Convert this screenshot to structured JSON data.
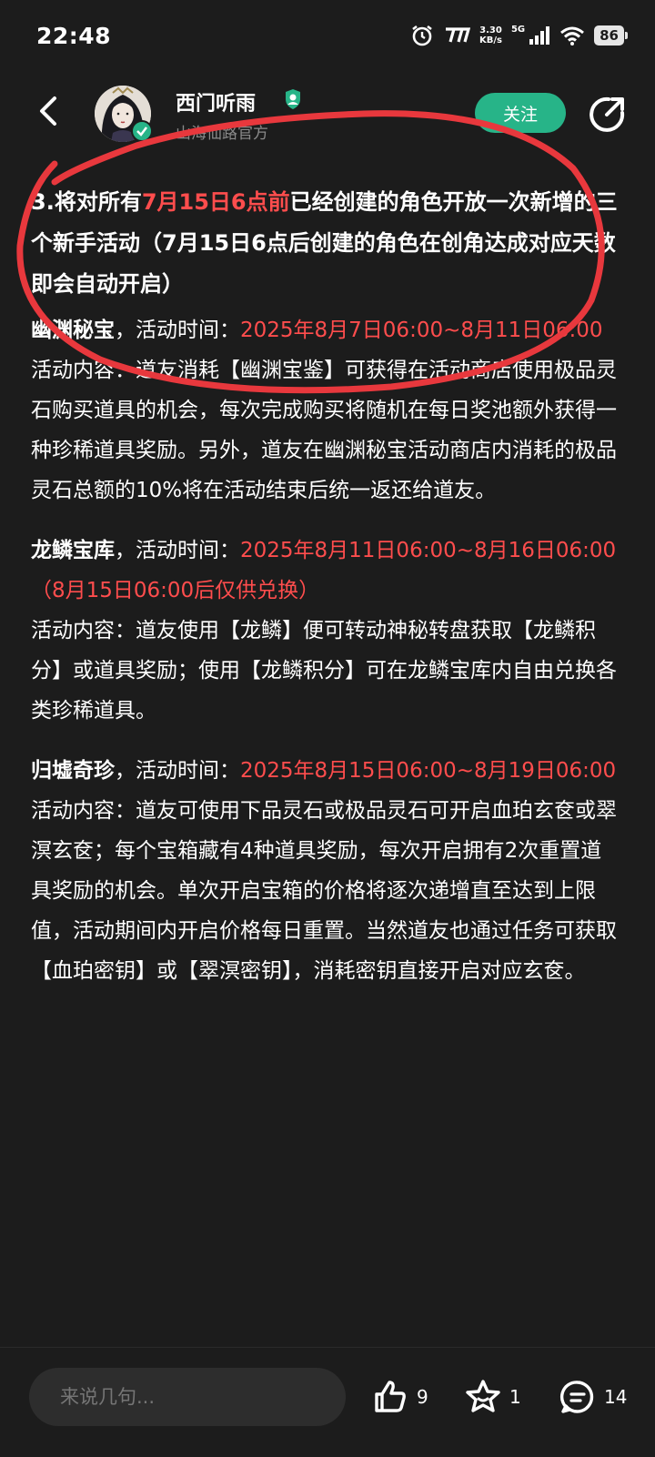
{
  "status_bar": {
    "time": "22:48",
    "net_speed_value": "3.30",
    "net_speed_unit": "KB/s",
    "network": "5G",
    "battery": "86"
  },
  "header": {
    "author_name": "西门听雨",
    "author_subtitle": "山海仙路官方",
    "follow_label": "关注"
  },
  "post": {
    "intro": {
      "prefix": "3.将对所有",
      "highlight": "7月15日6点前",
      "suffix": "已经创建的角色开放一次新增的三个新手活动（7月15日6点后创建的角色在创角达成对应天数即会自动开启）"
    },
    "activities": [
      {
        "name": "幽渊秘宝",
        "time_label": "，活动时间：",
        "time": "2025年8月7日06:00~8月11日06:00",
        "content": "活动内容：道友消耗【幽渊宝鉴】可获得在活动商店使用极品灵石购买道具的机会，每次完成购买将随机在每日奖池额外获得一种珍稀道具奖励。另外，道友在幽渊秘宝活动商店内消耗的极品灵石总额的10%将在活动结束后统一返还给道友。"
      },
      {
        "name": "龙鳞宝库",
        "time_label": "，活动时间：",
        "time": "2025年8月11日06:00~8月16日06:00（8月15日06:00后仅供兑换）",
        "content": "活动内容：道友使用【龙鳞】便可转动神秘转盘获取【龙鳞积分】或道具奖励；使用【龙鳞积分】可在龙鳞宝库内自由兑换各类珍稀道具。"
      },
      {
        "name": "归墟奇珍",
        "time_label": "，活动时间：",
        "time": "2025年8月15日06:00~8月19日06:00",
        "content": "活动内容：道友可使用下品灵石或极品灵石可开启血珀玄奁或翠溟玄奁；每个宝箱藏有4种道具奖励，每次开启拥有2次重置道具奖励的机会。单次开启宝箱的价格将逐次递增直至达到上限值，活动期间内开启价格每日重置。当然道友也通过任务可获取【血珀密钥】或【翠溟密钥】，消耗密钥直接开启对应玄奁。"
      }
    ]
  },
  "bottom_bar": {
    "comment_placeholder": "来说几句...",
    "like_count": "9",
    "favorite_count": "1",
    "comment_count": "14"
  },
  "colors": {
    "background": "#1c1c1c",
    "highlight": "#ff4d4d",
    "follow_button": "#27b488",
    "annotation": "#e8383d"
  }
}
